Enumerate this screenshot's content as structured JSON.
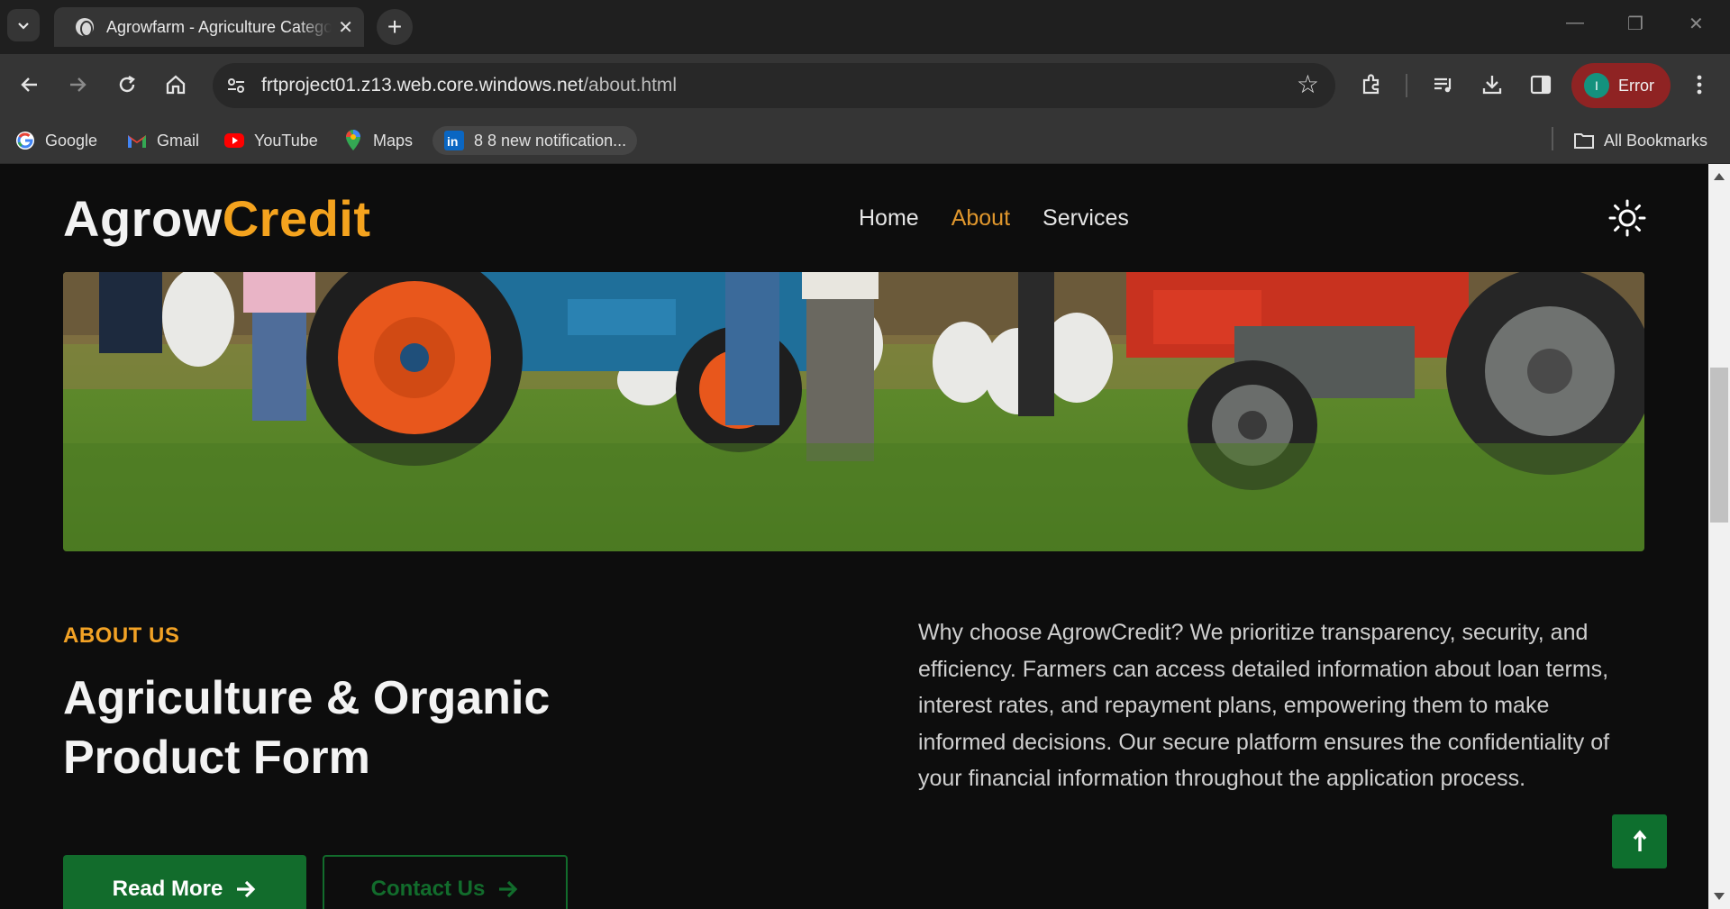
{
  "browser": {
    "tab": {
      "title": "Agrowfarm - Agriculture Category"
    },
    "address_bar": {
      "url_host": "frtproject01.z13.web.core.windows.net",
      "url_path": "/about.html"
    },
    "profile": {
      "initial": "I",
      "label": "Error",
      "color": "#8f2323"
    },
    "bookmarks": [
      {
        "label": "Google",
        "icon": "google-icon"
      },
      {
        "label": "Gmail",
        "icon": "gmail-icon"
      },
      {
        "label": "YouTube",
        "icon": "youtube-icon"
      },
      {
        "label": "Maps",
        "icon": "maps-icon"
      },
      {
        "label": "8 8 new notification...",
        "icon": "linkedin-icon"
      }
    ],
    "all_bookmarks_label": "All Bookmarks"
  },
  "site": {
    "brand_part1": "Agrow",
    "brand_part2": "Credit",
    "accent_color": "#f4a31e",
    "nav": [
      {
        "label": "Home",
        "active": false
      },
      {
        "label": "About",
        "active": true
      },
      {
        "label": "Services",
        "active": false
      }
    ]
  },
  "about": {
    "eyebrow": "ABOUT US",
    "heading": "Agriculture & Organic Product Form",
    "description": "Why choose AgrowCredit? We prioritize transparency, security, and efficiency. Farmers can access detailed information about loan terms, interest rates, and repayment plans, empowering them to make informed decisions. Our secure platform ensures the confidentiality of your financial information throughout the application process.",
    "primary_button": "Read More",
    "secondary_button": "Contact Us",
    "button_color": "#126c2c"
  }
}
